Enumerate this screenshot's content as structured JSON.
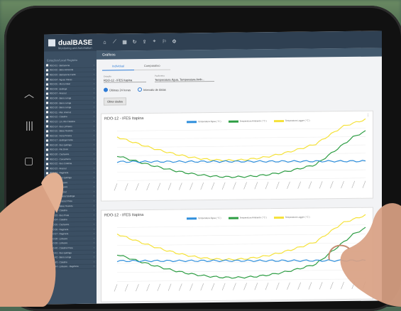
{
  "app": {
    "brand": "dualBASE",
    "brand_sub": "Monitoring and Automation",
    "page_title": "Gráficos"
  },
  "sidebar": {
    "heading": "Estações/Local Registro",
    "items": [
      "RDO-01 - Barbacena",
      "RDO-02 - Belo Horizonte",
      "RDO-03 - Barbacena Fonte",
      "RDO-04 - Aguas Claras",
      "RDO-05 - Morro Ideal",
      "RDO-06 - Ipatinga",
      "RDO-07 - Aracruz",
      "RDO-08 - Barra Longa",
      "RDO-09 - Barra Longa",
      "RDO-10 - Barra Longa",
      "RDO-11 - Mar. Aracruz",
      "RDO-12 - Colatina",
      "RDO-13 - Lin. Rio Colatina",
      "RDO-14 - Ibes Linhares",
      "RDO-15 - Baixo Guandu",
      "RDO-16 - Feira Pereira",
      "RDO-17 - Ipatinga Fonte",
      "RDO-18 - Ibes Ipatinga",
      "RDO-19 - Rio Doce",
      "RDO-20 - Cachoeira",
      "RDO-21 - Conselheiro",
      "RDO-22 - Ibes Colatina",
      "RDO-23 - Aracruz",
      "RDO-24 - Regência",
      "RDO-25 - Ibes Ipatinga",
      "RDO-26 - Linhares",
      "RDO-27 - Linhares",
      "RDO-28 - Aracruz",
      "RDO-29 - Aracruz Ipatinga",
      "RDO-30 - Aracruz Praia",
      "RDO-31 - Baixo Guandu",
      "RDO-32 - Colatina",
      "RDO-33 - Ibes Praia",
      "RDO-34 - Colatina",
      "RDO-35 - Cachoeira",
      "RDO-36 - Regência",
      "RDO-37 - Regência",
      "RDO-38 - Linhares",
      "RDO-39 - Linhares",
      "RDO-40 - Colatina Praia",
      "RDO-41 - Ibes Ipatinga",
      "RDO-42 - Barra Longa",
      "RDO-43 - Colatina",
      "RDO-44 - Linhares - Regência"
    ]
  },
  "topbar_icons": [
    "home-icon",
    "chart-icon",
    "grid-icon",
    "refresh-icon",
    "upload-icon",
    "location-icon",
    "alarm-icon",
    "settings-icon"
  ],
  "tabs": [
    "Individual",
    "Comparativo"
  ],
  "filters": {
    "station_label": "Estação",
    "station_value": "RDO-12 - IFES Itapina",
    "params_label": "Parâmetro",
    "params_value": "Temperatura Água, Temperatura Amb..."
  },
  "radios": {
    "last_24h": "Últimas 24 horas",
    "interval": "Intervalo de datas"
  },
  "button": {
    "fetch": "Obter dados"
  },
  "charts": [
    {
      "title": "RDO-12 - IFES Itapina",
      "more": "⋮"
    },
    {
      "title": "RDO-12 - IFES Itapina"
    }
  ],
  "legend": [
    {
      "name": "Temperatura Água ( °C )",
      "color": "#2f8fdc"
    },
    {
      "name": "Temperatura Ambiente ( °C )",
      "color": "#2e9e44"
    },
    {
      "name": "Temperatura Logger ( °C )",
      "color": "#f5e23a"
    }
  ],
  "colors": {
    "water": "#2f8fdc",
    "ambient": "#2e9e44",
    "logger": "#f5e23a",
    "sidebar": "#3b4f63",
    "topbar": "#2f4052"
  }
}
